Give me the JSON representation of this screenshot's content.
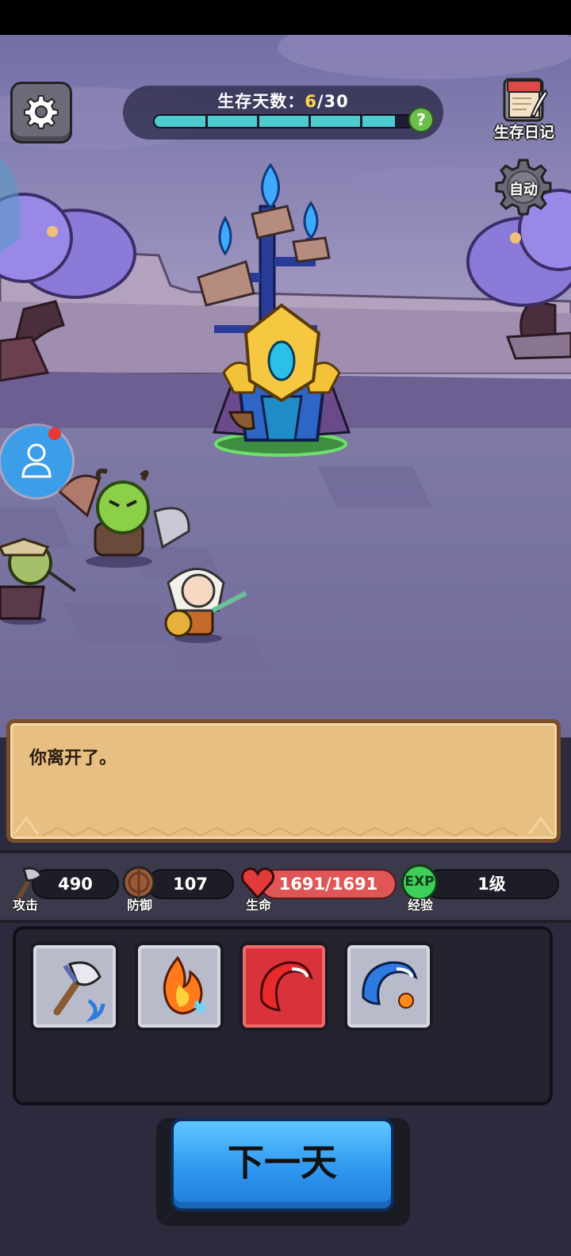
{
  "hud": {
    "days_label": "生存天数：",
    "days_current": "6",
    "days_total": "/30",
    "days_progress": 0.93,
    "help_text": "?",
    "diary_label": "生存日记",
    "auto_label": "自动"
  },
  "message": {
    "text": "你离开了。"
  },
  "stats": {
    "attack": {
      "value": "490",
      "label": "攻击"
    },
    "defense": {
      "value": "107",
      "label": "防御"
    },
    "hp": {
      "value": "1691/1691",
      "label": "生命"
    },
    "exp": {
      "value": "1级",
      "label": "经验",
      "badge": "EXP"
    }
  },
  "skills": {
    "items": [
      {
        "icon": "axe-skill-icon"
      },
      {
        "icon": "fire-frost-skill-icon"
      },
      {
        "icon": "red-slash-skill-icon"
      },
      {
        "icon": "blue-slash-skill-icon"
      }
    ]
  },
  "next_day_label": "下一天",
  "colors": {
    "progress": "#4ecbd0",
    "hp": "#e05555",
    "next_button": "#2f98f0",
    "message_bg": "#e7bf82"
  }
}
